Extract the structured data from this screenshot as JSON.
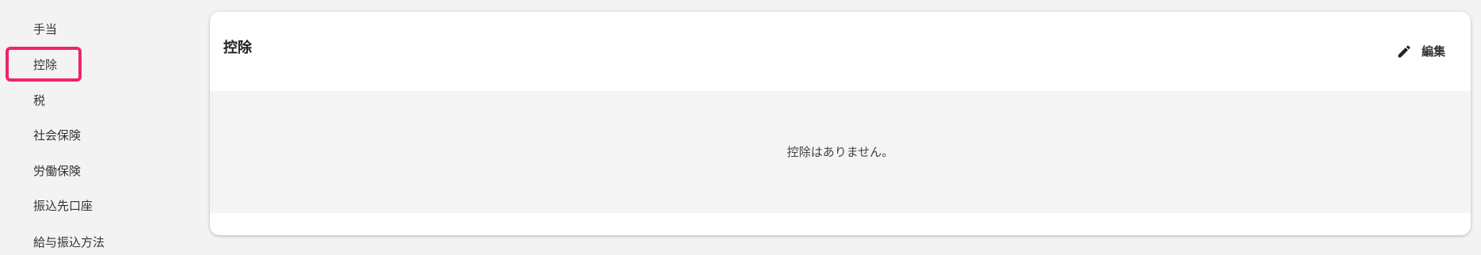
{
  "sidebar": {
    "items": [
      {
        "label": "手当"
      },
      {
        "label": "控除"
      },
      {
        "label": "税"
      },
      {
        "label": "社会保険"
      },
      {
        "label": "労働保険"
      },
      {
        "label": "振込先口座"
      },
      {
        "label": "給与振込方法"
      }
    ],
    "highlight_color": "#f0246e"
  },
  "card": {
    "title": "控除",
    "edit_label": "編集",
    "edit_icon": "pencil-icon",
    "empty_message": "控除はありません。"
  }
}
